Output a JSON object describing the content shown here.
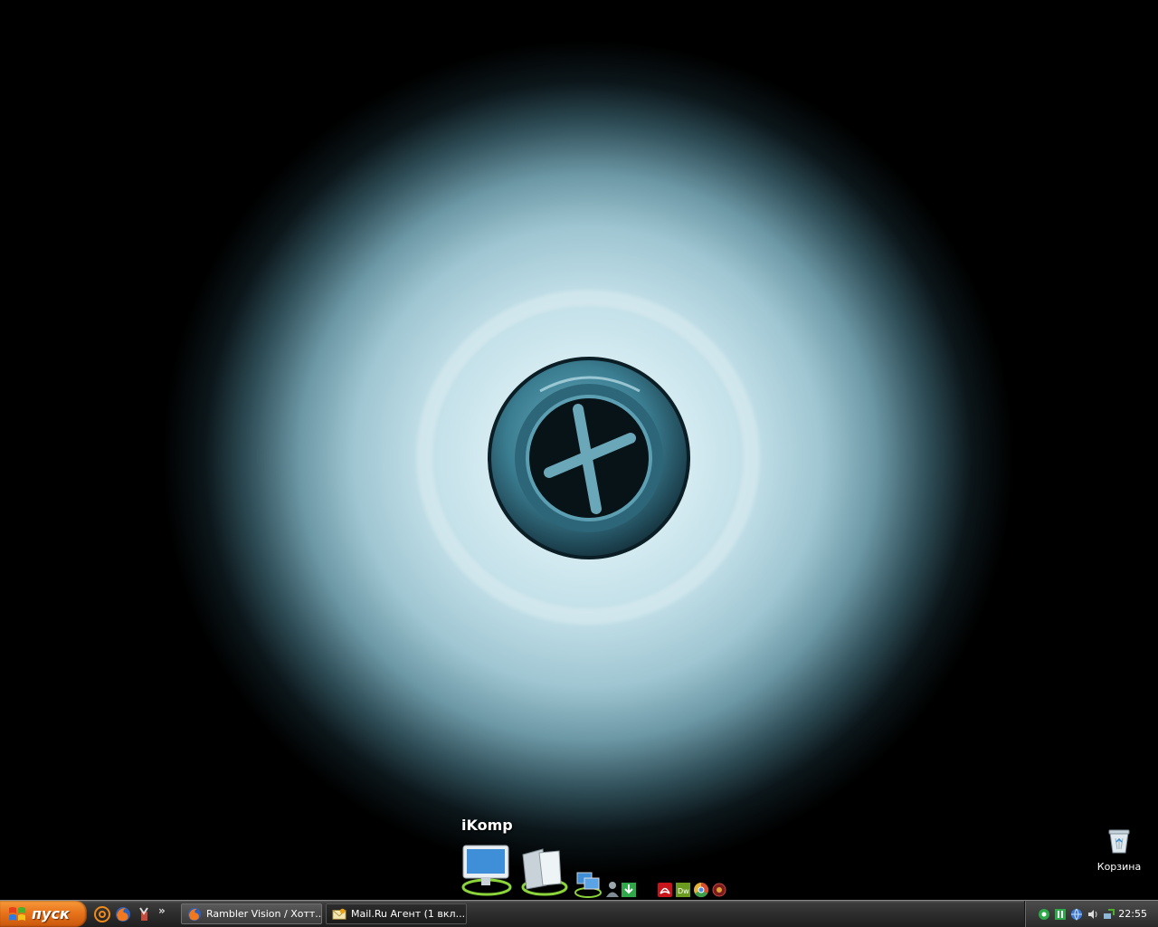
{
  "desktop": {
    "recycle_bin_label": "Корзина",
    "wallpaper_icon": "sink-drain-wallpaper"
  },
  "dock": {
    "label": "iKomp",
    "items": [
      "computer-icon",
      "documents-icon",
      "network-icon",
      "user-icon",
      "download-icon",
      "acrobat-icon",
      "dreamweaver-icon",
      "chrome-like-icon",
      "agent-icon"
    ]
  },
  "taskbar": {
    "start_label": "пуск",
    "quick_launch_more": "»",
    "quick_launch": [
      "mail-at-icon",
      "firefox-icon",
      "tool-icon"
    ],
    "tasks": [
      {
        "label": "Rambler Vision / Хотт...",
        "icon": "firefox-icon",
        "active": false
      },
      {
        "label": "Mail.Ru Агент (1 вкл...",
        "icon": "mail-envelope-icon",
        "active": true
      }
    ],
    "tray_icons": [
      "agent-tray-icon",
      "green-square-icon",
      "network-globe-icon",
      "volume-icon",
      "connection-icon"
    ],
    "clock": "22:55"
  },
  "colors": {
    "start_orange": "#e8741c",
    "taskbar_dark": "#2d2d2d",
    "wallpaper_light": "#d6ecf2"
  }
}
